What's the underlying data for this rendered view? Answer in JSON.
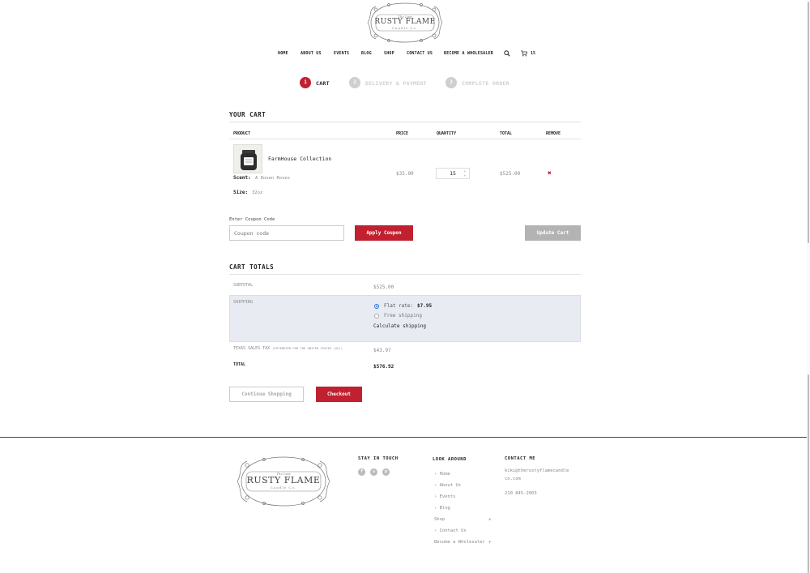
{
  "brand": {
    "name": "RUSTY FLAME",
    "tagline_top": "The Last",
    "tagline_bottom": "Candle Co."
  },
  "nav": {
    "items": [
      "HOME",
      "ABOUT US",
      "EVENTS",
      "BLOG",
      "SHOP",
      "CONTACT US",
      "BECOME A WHOLESALER"
    ],
    "cart_count": "15"
  },
  "steps": [
    {
      "num": "1",
      "label": "CART",
      "active": true
    },
    {
      "num": "2",
      "label": "DELIVERY & PAYMENT",
      "active": false
    },
    {
      "num": "3",
      "label": "COMPLETE ORDER",
      "active": false
    }
  ],
  "cart": {
    "title": "YOUR CART",
    "headers": {
      "product": "PRODUCT",
      "price": "PRICE",
      "quantity": "QUANTITY",
      "total": "TOTAL",
      "remove": "REMOVE"
    },
    "item": {
      "name": "FarmHouse Collection",
      "scent_label": "Scent:",
      "scent_value": "A Dozen Roses",
      "size_label": "Size:",
      "size_value": "32oz",
      "price": "$35.00",
      "quantity": "15",
      "total": "$525.00",
      "remove_symbol": "✖"
    }
  },
  "coupon": {
    "label": "Enter Coupon Code",
    "placeholder": "Coupon code",
    "apply_label": "Apply Coupon",
    "update_label": "Update Cart"
  },
  "totals": {
    "title": "CART TOTALS",
    "subtotal_label": "SUBTOTAL",
    "subtotal_value": "$525.00",
    "shipping_label": "SHIPPING",
    "flat_rate_label": "Flat rate:",
    "flat_rate_value": "$7.95",
    "free_shipping_label": "Free shipping",
    "calculate_label": "Calculate shipping",
    "tax_label": "TEXAS SALES TAX",
    "tax_note": "(ESTIMATED FOR THE UNITED STATES (US))",
    "tax_value": "$43.97",
    "total_label": "TOTAL",
    "total_value": "$576.92",
    "continue_label": "Continue Shopping",
    "checkout_label": "Checkout"
  },
  "footer": {
    "stay_title": "STAY IN TOUCH",
    "look_title": "LOOK AROUND",
    "contact_title": "CONTACT ME",
    "links": [
      "› Home",
      "› About Us",
      "› Events",
      "› Blog",
      "Shop",
      "› Contact Us",
      "Become a Wholesaler"
    ],
    "email_line1": "kiki@therustyflamecandle",
    "email_line2": "co.com",
    "phone": "210 845-2003",
    "social_icons": [
      "facebook-icon",
      "instagram-icon",
      "pinterest-icon"
    ]
  },
  "colors": {
    "accent": "#c0202f",
    "inactive_step": "#cfcfcf",
    "shipping_bg": "#e9ebf3"
  }
}
